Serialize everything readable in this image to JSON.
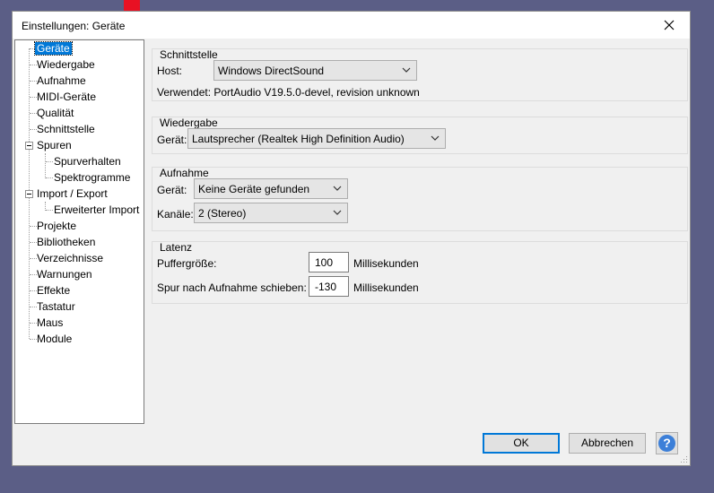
{
  "window": {
    "title": "Einstellungen: Geräte"
  },
  "tree": {
    "items": [
      {
        "label": "Geräte",
        "selected": true
      },
      {
        "label": "Wiedergabe"
      },
      {
        "label": "Aufnahme"
      },
      {
        "label": "MIDI-Geräte"
      },
      {
        "label": "Qualität"
      },
      {
        "label": "Schnittstelle"
      },
      {
        "label": "Spuren",
        "expanded": true
      },
      {
        "label": "Spurverhalten"
      },
      {
        "label": "Spektrogramme"
      },
      {
        "label": "Import / Export",
        "expanded": true
      },
      {
        "label": "Erweiterter Import"
      },
      {
        "label": "Projekte"
      },
      {
        "label": "Bibliotheken"
      },
      {
        "label": "Verzeichnisse"
      },
      {
        "label": "Warnungen"
      },
      {
        "label": "Effekte"
      },
      {
        "label": "Tastatur"
      },
      {
        "label": "Maus"
      },
      {
        "label": "Module"
      }
    ]
  },
  "interface": {
    "title": "Schnittstelle",
    "host_label": "Host:",
    "host_value": "Windows DirectSound",
    "using_text": "Verwendet: PortAudio V19.5.0-devel, revision unknown"
  },
  "playback": {
    "title": "Wiedergabe",
    "device_label": "Gerät:",
    "device_value": "Lautsprecher (Realtek High Definition Audio)"
  },
  "recording": {
    "title": "Aufnahme",
    "device_label": "Gerät:",
    "device_value": "Keine Geräte gefunden",
    "channels_label": "Kanäle:",
    "channels_value": "2 (Stereo)"
  },
  "latency": {
    "title": "Latenz",
    "buffer_label": "Puffergröße:",
    "buffer_value": "100",
    "buffer_unit": "Millisekunden",
    "shift_label": "Spur nach Aufnahme schieben:",
    "shift_value": "-130",
    "shift_unit": "Millisekunden"
  },
  "buttons": {
    "ok": "OK",
    "cancel": "Abbrechen",
    "help": "?"
  },
  "colors": {
    "accent": "#0078d7",
    "desktop": "#5b5e86",
    "help_icon": "#3c7fd8"
  }
}
